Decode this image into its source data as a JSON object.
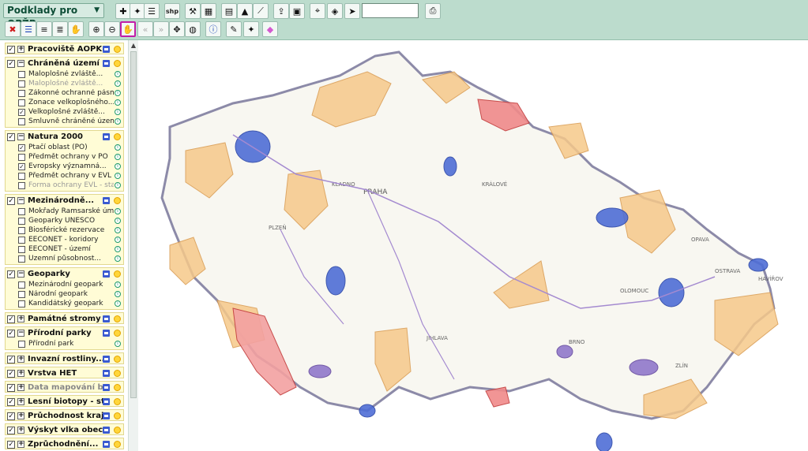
{
  "app": {
    "title": "Podklady pro OPŽP"
  },
  "toolbar": {
    "shp_label": "shp",
    "search_value": "",
    "search_placeholder": ""
  },
  "layers": {
    "groups": [
      {
        "title": "Pracoviště AOPK ČR",
        "checked": true,
        "expanded": false,
        "items": []
      },
      {
        "title": "Chráněná území",
        "checked": true,
        "expanded": true,
        "items": [
          {
            "label": "Maloplošné zvláště...",
            "checked": false,
            "gray": false
          },
          {
            "label": "Maloplošné zvláště...",
            "checked": false,
            "gray": true
          },
          {
            "label": "Zákonné ochranné pásmo...",
            "checked": false,
            "gray": false
          },
          {
            "label": "Zonace velkoplošného...",
            "checked": false,
            "gray": false
          },
          {
            "label": "Velkoplošné zvláště...",
            "checked": true,
            "gray": false
          },
          {
            "label": "Smluvně chráněné území",
            "checked": false,
            "gray": false
          }
        ]
      },
      {
        "title": "Natura 2000",
        "checked": true,
        "expanded": true,
        "items": [
          {
            "label": "Ptačí oblast (PO)",
            "checked": true,
            "gray": false
          },
          {
            "label": "Předmět ochrany v PO",
            "checked": false,
            "gray": false
          },
          {
            "label": "Evropsky významná...",
            "checked": true,
            "gray": false
          },
          {
            "label": "Předmět ochrany v EVL",
            "checked": false,
            "gray": false
          },
          {
            "label": "Forma ochrany EVL - stav...",
            "checked": false,
            "gray": true
          }
        ]
      },
      {
        "title": "Mezinárodně...",
        "checked": true,
        "expanded": true,
        "items": [
          {
            "label": "Mokřady Ramsarské úmluvy",
            "checked": false,
            "gray": false
          },
          {
            "label": "Geoparky UNESCO",
            "checked": false,
            "gray": false
          },
          {
            "label": "Biosférické rezervace",
            "checked": false,
            "gray": false
          },
          {
            "label": "EECONET - koridory",
            "checked": false,
            "gray": false
          },
          {
            "label": "EECONET - území",
            "checked": false,
            "gray": false
          },
          {
            "label": "Územní působnost...",
            "checked": false,
            "gray": false
          }
        ]
      },
      {
        "title": "Geoparky",
        "checked": true,
        "expanded": true,
        "items": [
          {
            "label": "Mezinárodní geopark",
            "checked": false,
            "gray": false
          },
          {
            "label": "Národní geopark",
            "checked": false,
            "gray": false
          },
          {
            "label": "Kandidátský geopark",
            "checked": false,
            "gray": false
          }
        ]
      },
      {
        "title": "Památné stromy",
        "checked": true,
        "expanded": false,
        "items": []
      },
      {
        "title": "Přírodní parky",
        "checked": true,
        "expanded": true,
        "items": [
          {
            "label": "Přírodní park",
            "checked": false,
            "gray": false
          }
        ]
      },
      {
        "title": "Invazní rostliny...",
        "checked": true,
        "expanded": false,
        "items": []
      },
      {
        "title": "Vrstva HET",
        "checked": true,
        "expanded": false,
        "items": []
      },
      {
        "title": "Data mapování biotop",
        "checked": true,
        "expanded": false,
        "gray": true,
        "items": []
      },
      {
        "title": "Lesní biotopy - stav",
        "checked": true,
        "expanded": false,
        "items": []
      },
      {
        "title": "Průchodnost krajiny...",
        "checked": true,
        "expanded": false,
        "items": []
      },
      {
        "title": "Výskyt vlka obecného",
        "checked": true,
        "expanded": false,
        "items": []
      },
      {
        "title": "Zprůchodnění...",
        "checked": true,
        "expanded": false,
        "items": []
      },
      {
        "title": "",
        "checked": true,
        "expanded": false,
        "items": []
      }
    ]
  },
  "map": {
    "labels": [
      "PRAHA",
      "KLADNO",
      "PLZEŇ",
      "OLOMOUC",
      "OSTRAVA",
      "OPAVA",
      "JIHLAVA",
      "ZLÍN",
      "HAVÍŘOV",
      "KRÁLOVÉ",
      "BRNO"
    ],
    "colors": {
      "orange": "#f6c98a",
      "blue": "#4f6ed6",
      "red": "#f08a8a",
      "purple": "#8a70c8"
    }
  }
}
